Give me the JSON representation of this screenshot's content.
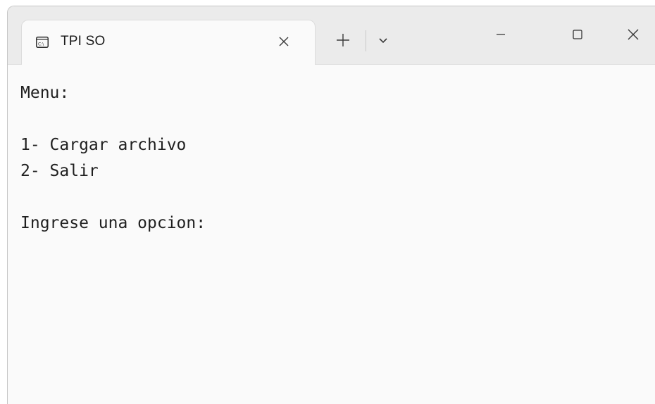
{
  "window": {
    "tab_title": "TPI SO",
    "tab_icon": "terminal-icon",
    "icons": {
      "tab_close": "close-icon",
      "new_tab": "plus-icon",
      "dropdown": "chevron-down-icon",
      "minimize": "minimize-icon",
      "maximize": "maximize-icon",
      "close": "close-icon"
    }
  },
  "terminal": {
    "lines": [
      "Menu:",
      "",
      "1- Cargar archivo",
      "2- Salir",
      "",
      "Ingrese una opcion:"
    ]
  },
  "colors": {
    "titlebar": "#ebebeb",
    "terminal_background": "#fafafa",
    "text": "#1f1f1f"
  }
}
